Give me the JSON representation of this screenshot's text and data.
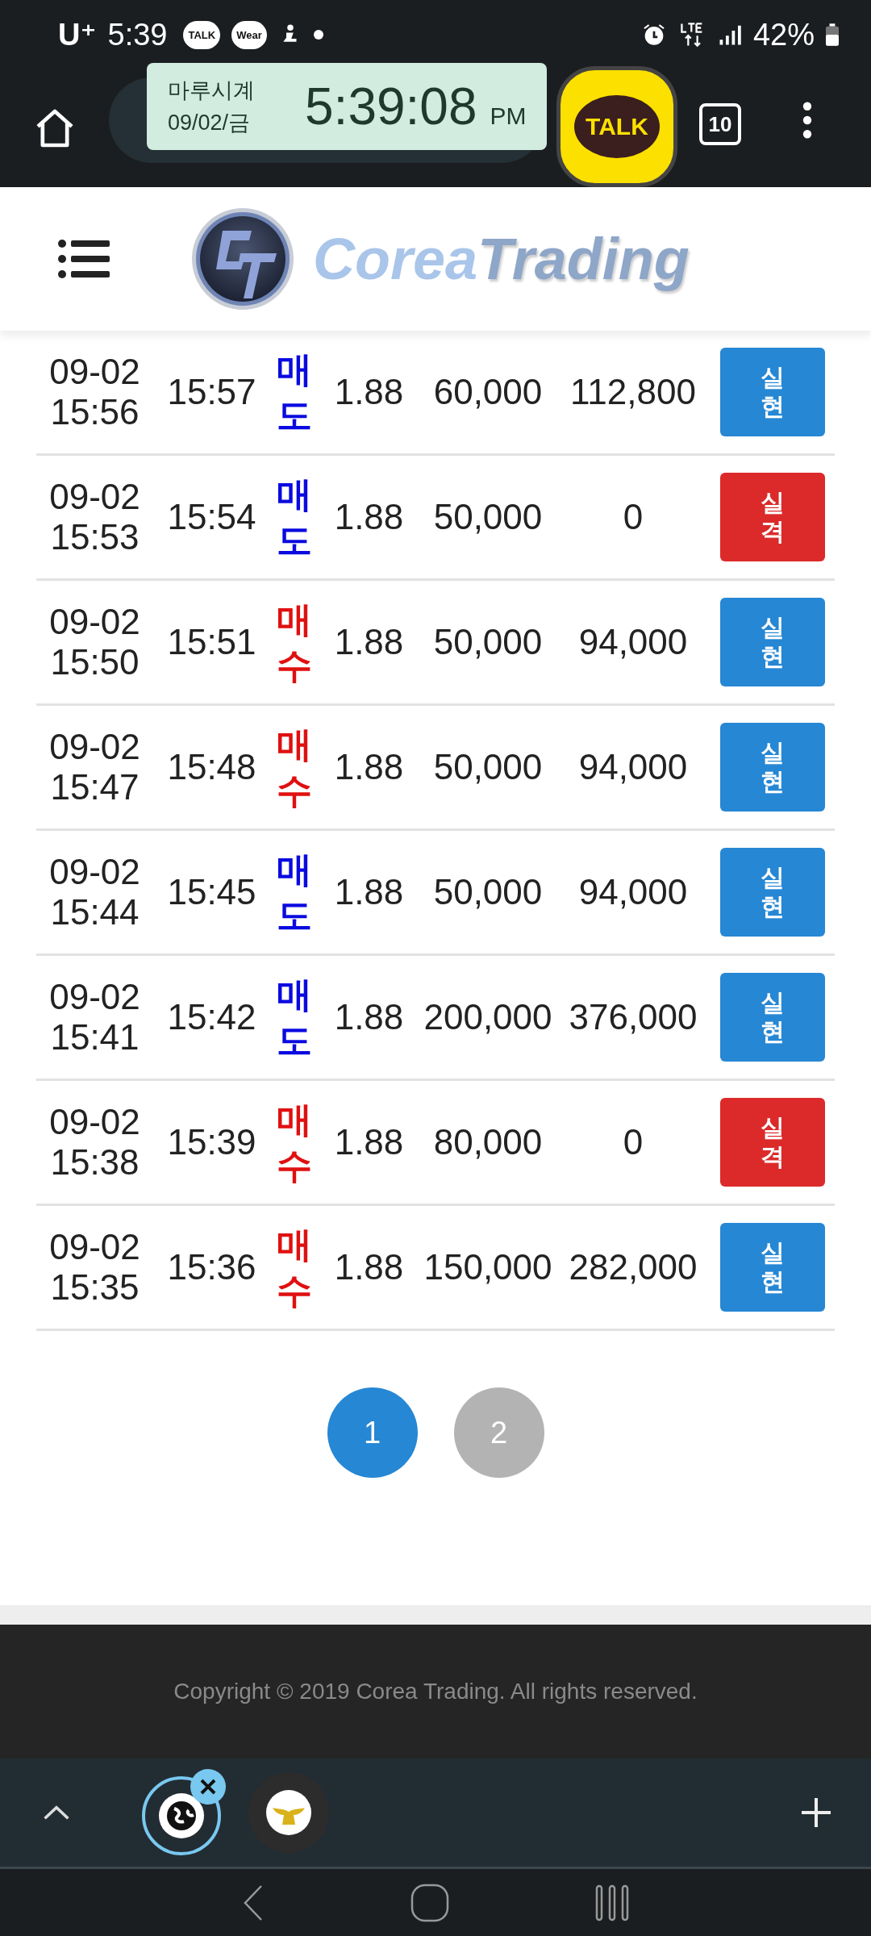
{
  "status_bar": {
    "carrier": "U⁺",
    "time": "5:39",
    "notification_icons": [
      "TALK",
      "Wear"
    ],
    "battery": "42%"
  },
  "browser": {
    "tab_count": "10"
  },
  "clock_overlay": {
    "app": "마루시계",
    "date": "09/02/금",
    "time": "5:39:08",
    "period": "PM"
  },
  "chat_bubble": {
    "label": "TALK"
  },
  "site": {
    "logo_first": "Corea",
    "logo_second": "Trading"
  },
  "rows": [
    {
      "start": "09-02",
      "start_time": "15:56",
      "end_time": "15:57",
      "side": {
        "label": "매도",
        "kind": "sell"
      },
      "rate": "1.88",
      "amount": "60,000",
      "payout": "112,800",
      "result": {
        "label": "실현",
        "kind": "win"
      }
    },
    {
      "start": "09-02",
      "start_time": "15:53",
      "end_time": "15:54",
      "side": {
        "label": "매도",
        "kind": "sell"
      },
      "rate": "1.88",
      "amount": "50,000",
      "payout": "0",
      "result": {
        "label": "실격",
        "kind": "lose"
      }
    },
    {
      "start": "09-02",
      "start_time": "15:50",
      "end_time": "15:51",
      "side": {
        "label": "매수",
        "kind": "buy"
      },
      "rate": "1.88",
      "amount": "50,000",
      "payout": "94,000",
      "result": {
        "label": "실현",
        "kind": "win"
      }
    },
    {
      "start": "09-02",
      "start_time": "15:47",
      "end_time": "15:48",
      "side": {
        "label": "매수",
        "kind": "buy"
      },
      "rate": "1.88",
      "amount": "50,000",
      "payout": "94,000",
      "result": {
        "label": "실현",
        "kind": "win"
      }
    },
    {
      "start": "09-02",
      "start_time": "15:44",
      "end_time": "15:45",
      "side": {
        "label": "매도",
        "kind": "sell"
      },
      "rate": "1.88",
      "amount": "50,000",
      "payout": "94,000",
      "result": {
        "label": "실현",
        "kind": "win"
      }
    },
    {
      "start": "09-02",
      "start_time": "15:41",
      "end_time": "15:42",
      "side": {
        "label": "매도",
        "kind": "sell"
      },
      "rate": "1.88",
      "amount": "200,000",
      "payout": "376,000",
      "result": {
        "label": "실현",
        "kind": "win"
      }
    },
    {
      "start": "09-02",
      "start_time": "15:38",
      "end_time": "15:39",
      "side": {
        "label": "매수",
        "kind": "buy"
      },
      "rate": "1.88",
      "amount": "80,000",
      "payout": "0",
      "result": {
        "label": "실격",
        "kind": "lose"
      }
    },
    {
      "start": "09-02",
      "start_time": "15:35",
      "end_time": "15:36",
      "side": {
        "label": "매수",
        "kind": "buy"
      },
      "rate": "1.88",
      "amount": "150,000",
      "payout": "282,000",
      "result": {
        "label": "실현",
        "kind": "win"
      }
    }
  ],
  "pagination": [
    {
      "label": "1",
      "selected": true
    },
    {
      "label": "2",
      "selected": false
    }
  ],
  "footer": {
    "copyright": "Copyright © 2019 Corea Trading. All rights reserved."
  }
}
